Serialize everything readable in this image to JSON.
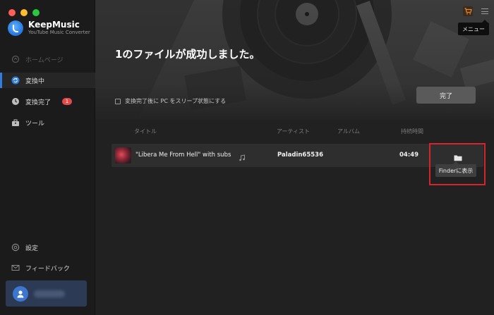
{
  "app": {
    "name": "KeepMusic",
    "subtitle": "YouTube Music Converter"
  },
  "sidebar": {
    "items": [
      {
        "label": "ホームページ",
        "icon": "home-icon",
        "state": "disabled"
      },
      {
        "label": "変換中",
        "icon": "sync-icon",
        "state": "active"
      },
      {
        "label": "変換完了",
        "icon": "clock-icon",
        "state": "normal",
        "badge": "1"
      },
      {
        "label": "ツール",
        "icon": "toolbox-icon",
        "state": "normal"
      }
    ],
    "bottom": [
      {
        "label": "設定",
        "icon": "gear-icon"
      },
      {
        "label": "フィードバック",
        "icon": "mail-icon"
      }
    ],
    "user": {
      "name": "username",
      "icon": "user-icon"
    }
  },
  "header": {
    "menu_tooltip": "メニュー",
    "cart_icon": "cart-icon",
    "menu_icon": "hamburger-menu-icon"
  },
  "hero": {
    "title": "1のファイルが成功しました。",
    "sleep_option": "変換完了後に PC をスリープ状態にする",
    "sleep_checked": false,
    "done_button": "完了"
  },
  "table": {
    "columns": [
      "タイトル",
      "アーティスト",
      "アルバム",
      "持続時間"
    ],
    "rows": [
      {
        "title": "\"Libera Me From Hell\" with subs",
        "artist": "Paladin65536",
        "album": "",
        "duration": "04:49",
        "action_tooltip": "Finderに表示"
      }
    ]
  },
  "colors": {
    "accent": "#2f7de0",
    "badge": "#e24b4b",
    "highlight": "#d6252a"
  }
}
